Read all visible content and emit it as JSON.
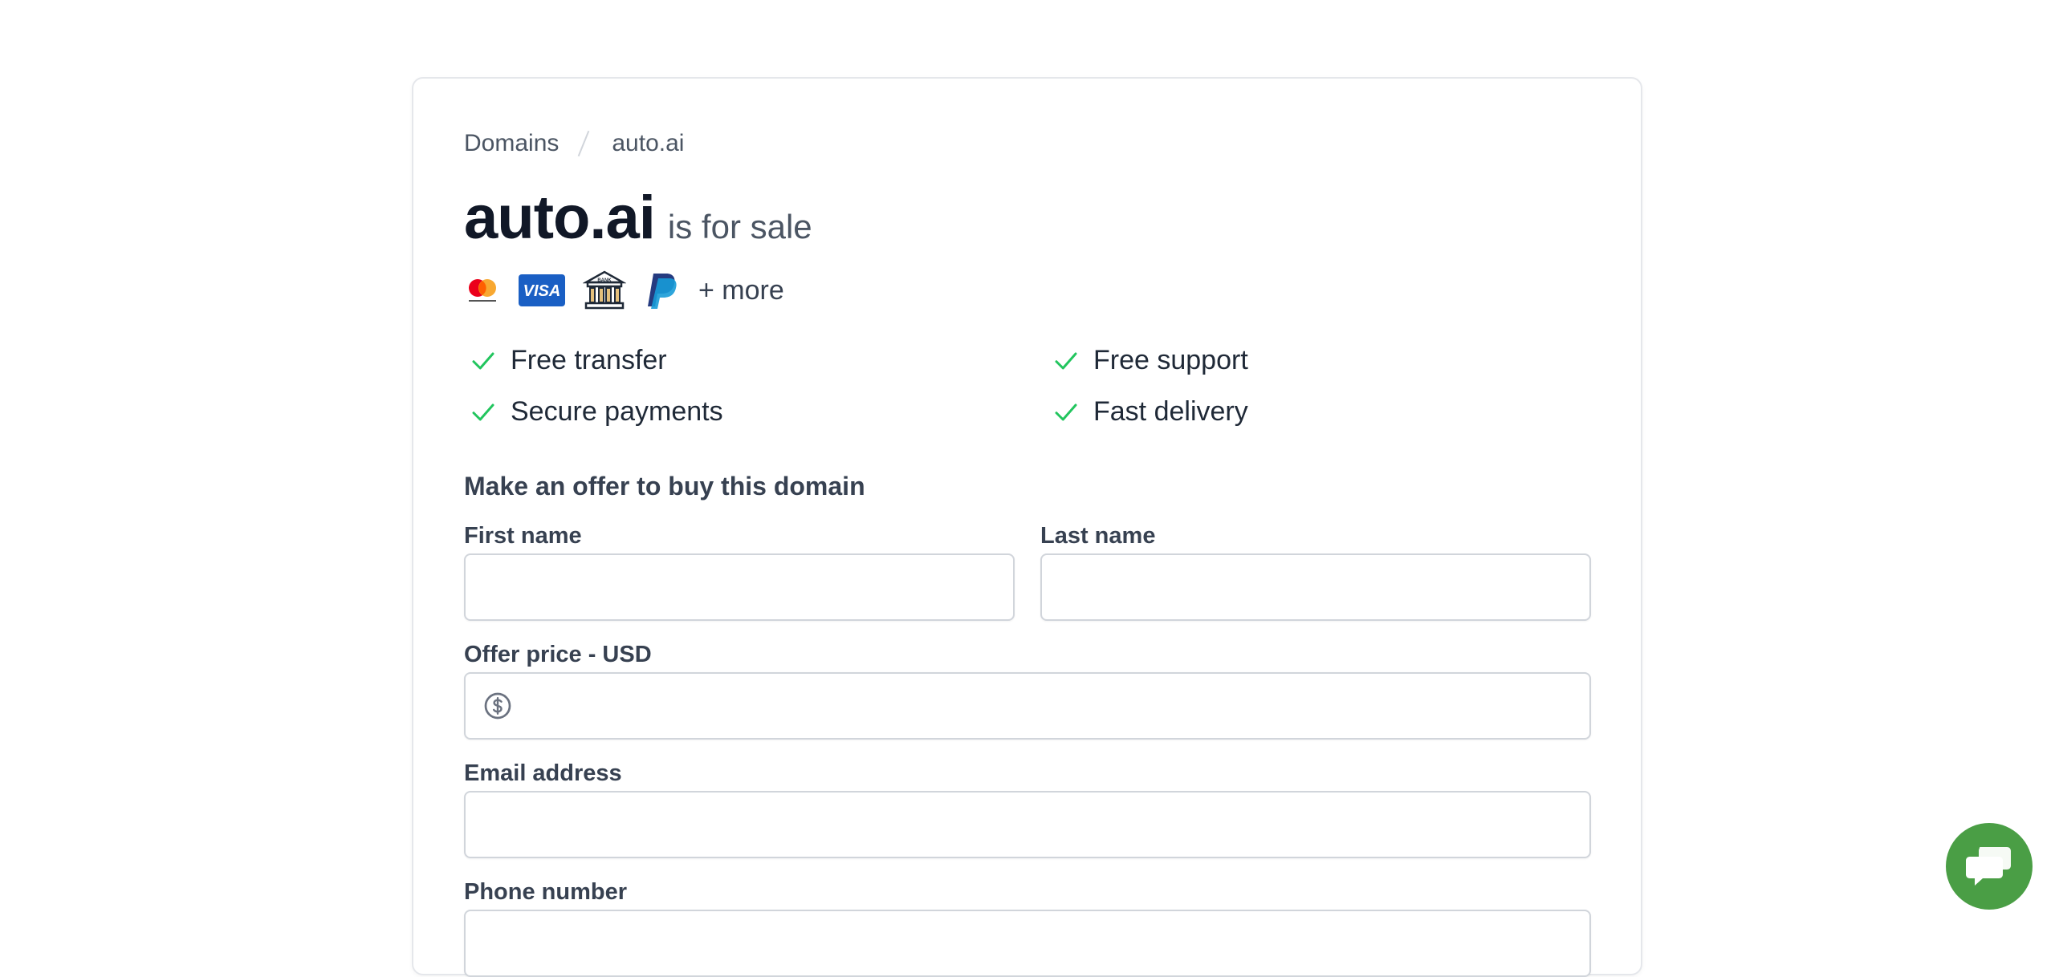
{
  "breadcrumb": {
    "root": "Domains",
    "current": "auto.ai"
  },
  "listing": {
    "domain": "auto.ai",
    "status": "is for sale"
  },
  "payments": {
    "icons": [
      "mastercard-icon",
      "visa-icon",
      "bank-icon",
      "paypal-icon"
    ],
    "more_label": "+ more"
  },
  "features": [
    {
      "label": "Free transfer"
    },
    {
      "label": "Free support"
    },
    {
      "label": "Secure payments"
    },
    {
      "label": "Fast delivery"
    }
  ],
  "offer_form": {
    "heading": "Make an offer to buy this domain",
    "first_name": {
      "label": "First name",
      "value": ""
    },
    "last_name": {
      "label": "Last name",
      "value": ""
    },
    "offer_price": {
      "label": "Offer price - USD",
      "value": ""
    },
    "email": {
      "label": "Email address",
      "value": ""
    },
    "phone": {
      "label": "Phone number",
      "value": ""
    }
  },
  "colors": {
    "check": "#22c55e",
    "chat_button": "#4a9e45",
    "border": "#d1d5db",
    "heading": "#111827"
  },
  "chat": {
    "icon": "chat-icon"
  }
}
